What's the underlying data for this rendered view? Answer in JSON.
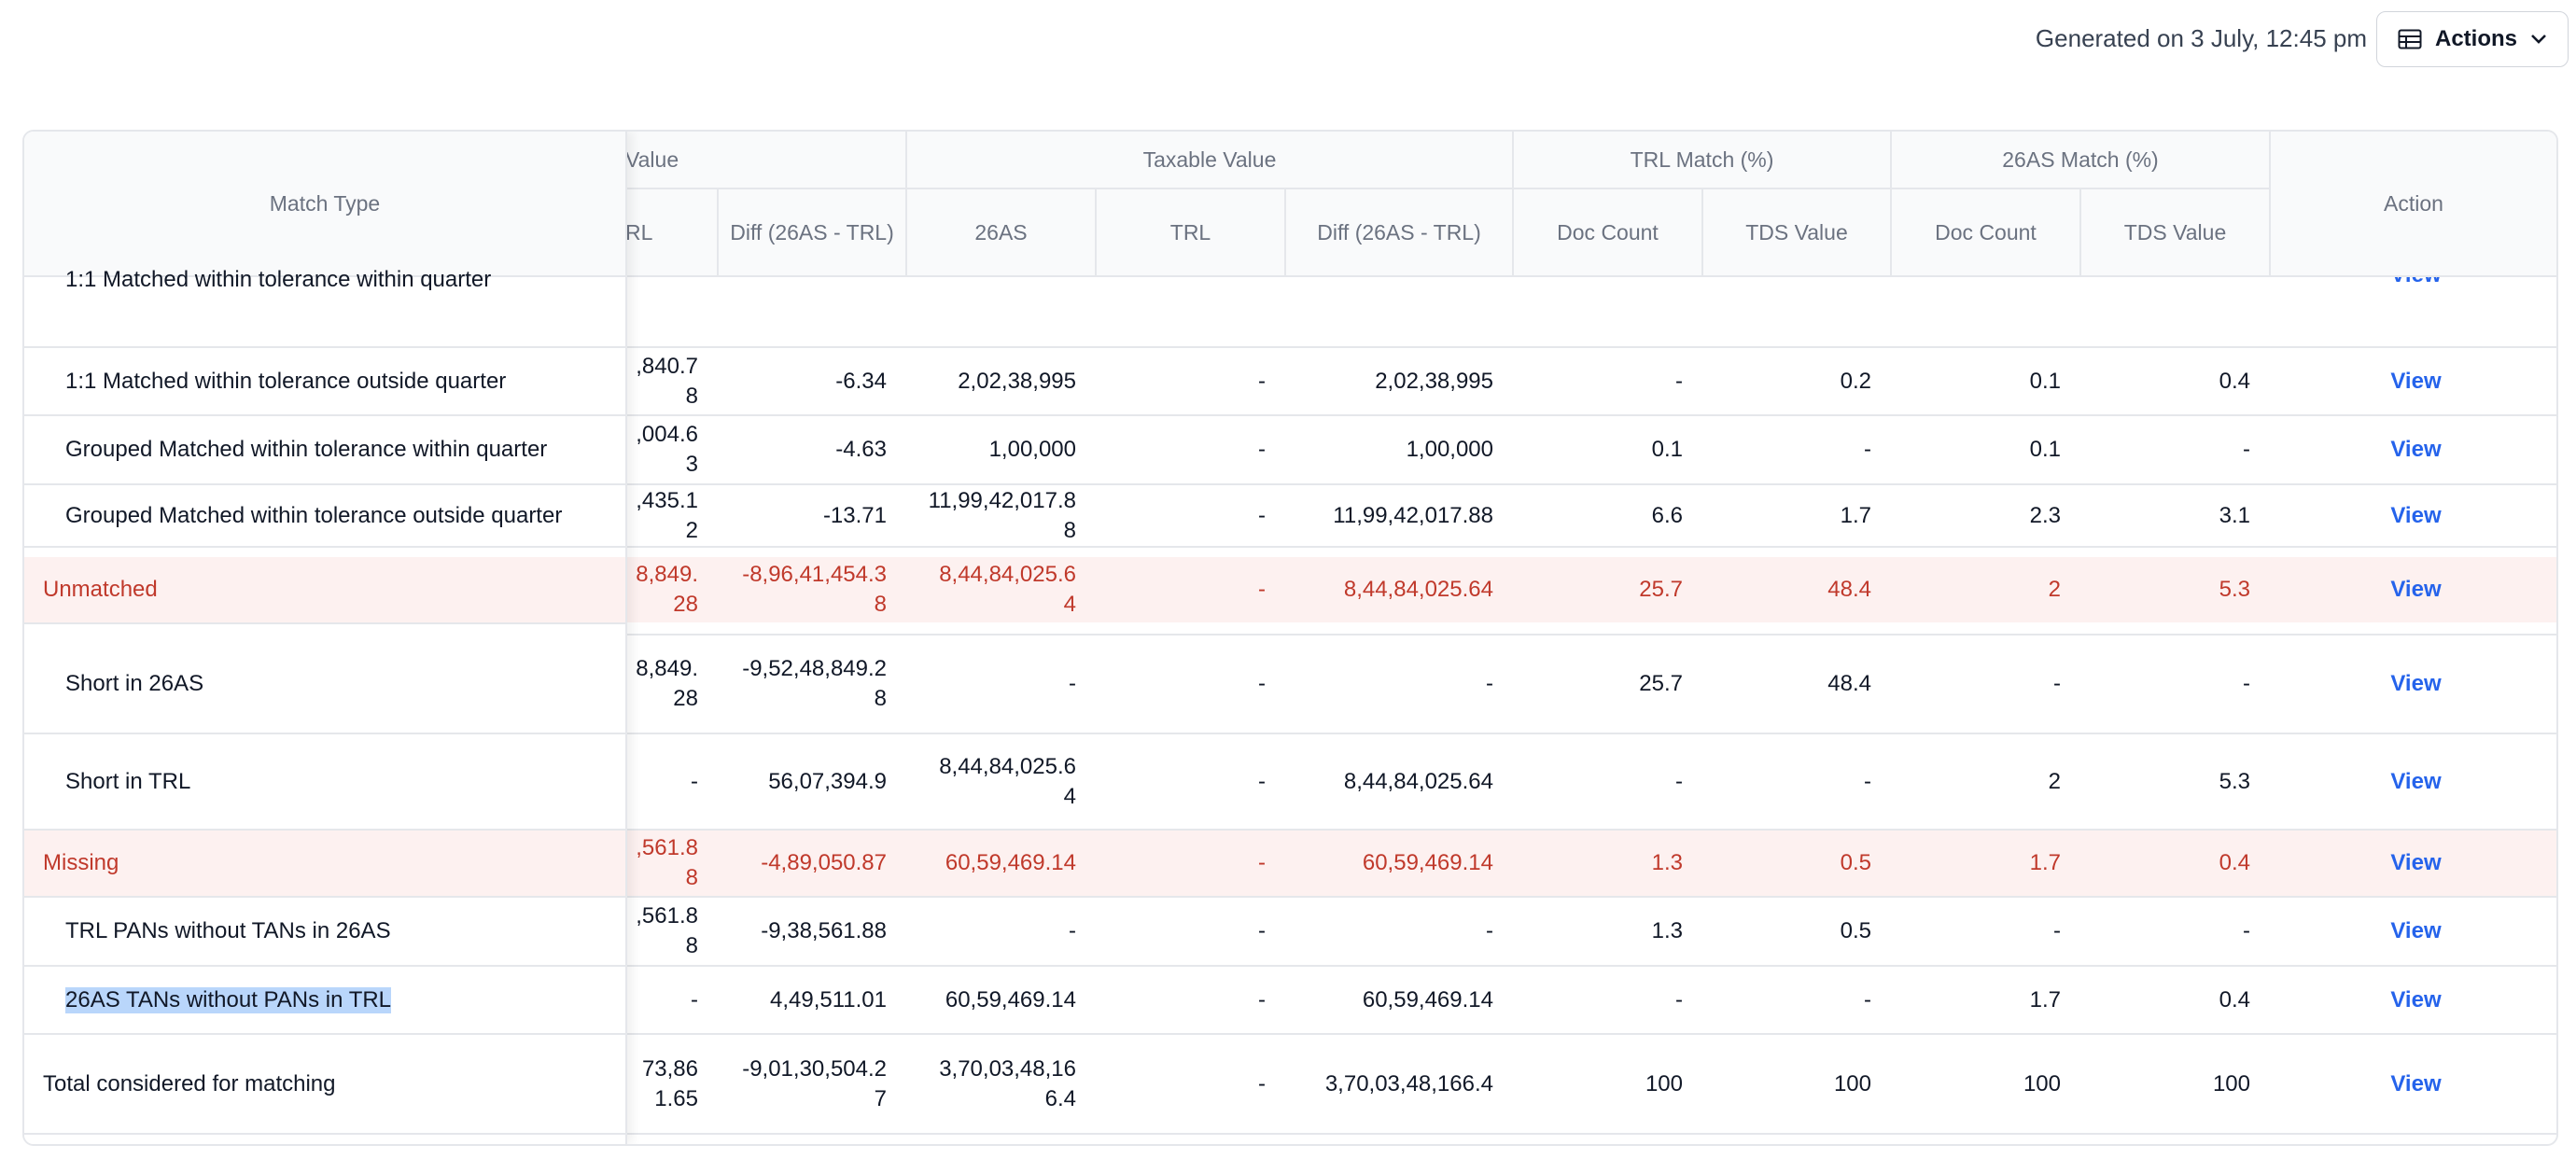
{
  "header": {
    "generated": "Generated on 3 July, 12:45 pm",
    "actions_label": "Actions"
  },
  "table": {
    "group_headers": {
      "value_partial": "Value",
      "taxable_value": "Taxable Value",
      "trl_match": "TRL Match (%)",
      "as26_match": "26AS Match (%)"
    },
    "col_headers": {
      "match_type": "Match Type",
      "trl_partial": "RL",
      "diff_value": "Diff (26AS - TRL)",
      "tax_26as": "26AS",
      "tax_trl": "TRL",
      "tax_diff": "Diff (26AS - TRL)",
      "trl_doc": "Doc Count",
      "trl_tds": "TDS Value",
      "as_doc": "Doc Count",
      "as_tds": "TDS Value",
      "action": "Action"
    },
    "partial_row": {
      "label": "1:1 Matched within tolerance within quarter",
      "action": "View"
    },
    "rows": [
      {
        "label": "1:1 Matched within tolerance outside quarter",
        "trl": ",840.78",
        "diff": "-6.34",
        "tax26": "2,02,38,995",
        "taxtrl": "-",
        "taxdiff": "2,02,38,995",
        "trldoc": "-",
        "trltds": "0.2",
        "asdoc": "0.1",
        "astds": "0.4",
        "action": "View"
      },
      {
        "label": "Grouped Matched within tolerance within quarter",
        "trl": ",004.63",
        "diff": "-4.63",
        "tax26": "1,00,000",
        "taxtrl": "-",
        "taxdiff": "1,00,000",
        "trldoc": "0.1",
        "trltds": "-",
        "asdoc": "0.1",
        "astds": "-",
        "action": "View"
      },
      {
        "label": "Grouped Matched within tolerance outside quarter",
        "trl": ",435.12",
        "diff": "-13.71",
        "tax26": "11,99,42,017.88",
        "taxtrl": "-",
        "taxdiff": "11,99,42,017.88",
        "trldoc": "6.6",
        "trltds": "1.7",
        "asdoc": "2.3",
        "astds": "3.1",
        "action": "View"
      },
      {
        "label": "Unmatched",
        "trl": "8,849.28",
        "diff": "-8,96,41,454.38",
        "tax26": "8,44,84,025.64",
        "taxtrl": "-",
        "taxdiff": "8,44,84,025.64",
        "trldoc": "25.7",
        "trltds": "48.4",
        "asdoc": "2",
        "astds": "5.3",
        "action": "View"
      },
      {
        "label": "Short in 26AS",
        "trl": "8,849.28",
        "diff": "-9,52,48,849.28",
        "tax26": "-",
        "taxtrl": "-",
        "taxdiff": "-",
        "trldoc": "25.7",
        "trltds": "48.4",
        "asdoc": "-",
        "astds": "-",
        "action": "View"
      },
      {
        "label": "Short in TRL",
        "trl": "-",
        "diff": "56,07,394.9",
        "tax26": "8,44,84,025.64",
        "taxtrl": "-",
        "taxdiff": "8,44,84,025.64",
        "trldoc": "-",
        "trltds": "-",
        "asdoc": "2",
        "astds": "5.3",
        "action": "View"
      },
      {
        "label": "Missing",
        "trl": ",561.88",
        "diff": "-4,89,050.87",
        "tax26": "60,59,469.14",
        "taxtrl": "-",
        "taxdiff": "60,59,469.14",
        "trldoc": "1.3",
        "trltds": "0.5",
        "asdoc": "1.7",
        "astds": "0.4",
        "action": "View"
      },
      {
        "label": "TRL PANs without TANs in 26AS",
        "trl": ",561.88",
        "diff": "-9,38,561.88",
        "tax26": "-",
        "taxtrl": "-",
        "taxdiff": "-",
        "trldoc": "1.3",
        "trltds": "0.5",
        "asdoc": "-",
        "astds": "-",
        "action": "View"
      },
      {
        "label": "26AS TANs without PANs in TRL",
        "trl": "-",
        "diff": "4,49,511.01",
        "tax26": "60,59,469.14",
        "taxtrl": "-",
        "taxdiff": "60,59,469.14",
        "trldoc": "-",
        "trltds": "-",
        "asdoc": "1.7",
        "astds": "0.4",
        "action": "View"
      },
      {
        "label": "Total considered for matching",
        "trl": "73,861.65",
        "diff": "-9,01,30,504.27",
        "tax26": "3,70,03,48,166.4",
        "taxtrl": "-",
        "taxdiff": "3,70,03,48,166.4",
        "trldoc": "100",
        "trltds": "100",
        "asdoc": "100",
        "astds": "100",
        "action": "View"
      }
    ]
  },
  "colors": {
    "accent_link": "#2563eb",
    "category_red": "#c0392b",
    "category_band": "#fdf1f0",
    "selection": "#b9d6fb"
  }
}
